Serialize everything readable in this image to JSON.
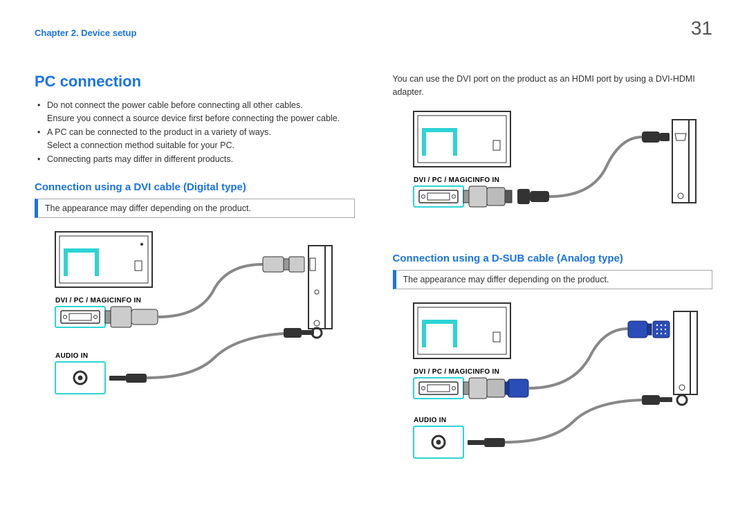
{
  "header": {
    "chapter": "Chapter 2. Device setup",
    "page": "31"
  },
  "left": {
    "h1": "PC connection",
    "bullets": [
      "Do not connect the power cable before connecting all other cables.\nEnsure you connect a source device first before connecting the power cable.",
      "A PC can be connected to the product in a variety of ways.\nSelect a connection method suitable for your PC.",
      "Connecting parts may differ in different products."
    ],
    "h2": "Connection using a DVI cable (Digital type)",
    "note": "The appearance may differ depending on the product.",
    "labels": {
      "dvi": "DVI / PC / MAGICINFO IN",
      "audio": "AUDIO IN"
    }
  },
  "right": {
    "intro": "You can use the DVI port on the product as an HDMI port by using a DVI-HDMI adapter.",
    "labels_top": {
      "dvi": "DVI / PC / MAGICINFO IN"
    },
    "h2": "Connection using a D-SUB cable (Analog type)",
    "note": "The appearance may differ depending on the product.",
    "labels_bottom": {
      "dvi": "DVI / PC / MAGICINFO IN",
      "audio": "AUDIO IN"
    }
  }
}
